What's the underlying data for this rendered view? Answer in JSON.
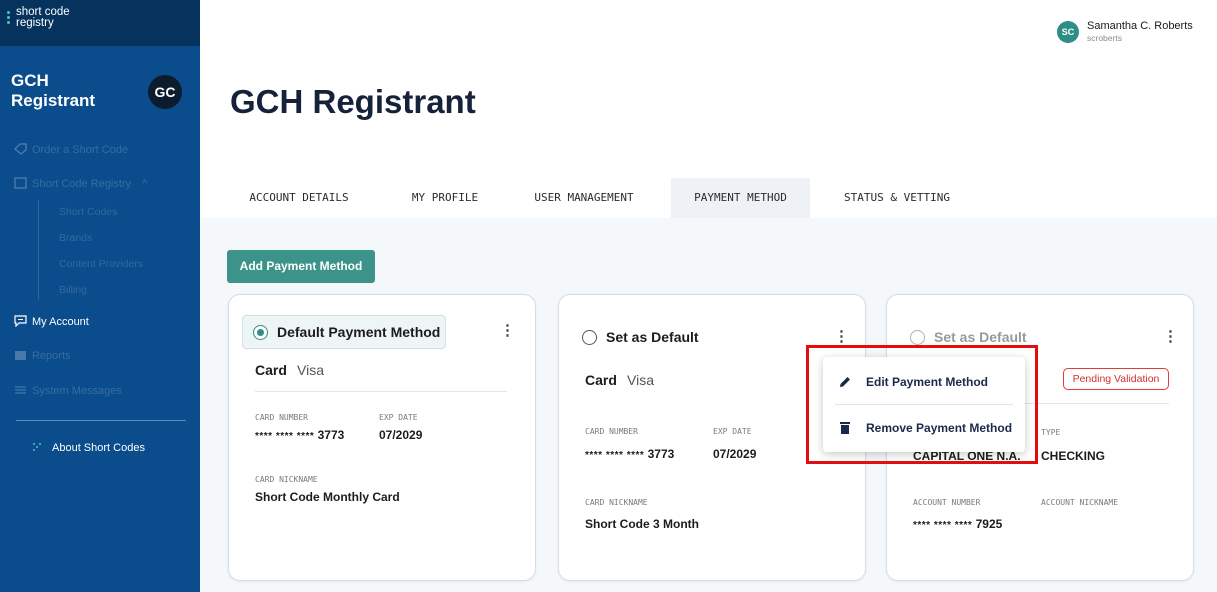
{
  "brand": {
    "line1": "short code",
    "line2": "registry"
  },
  "sidebar": {
    "org_name": "GCH Registrant",
    "org_initials": "GC",
    "items": [
      {
        "label": "Order a Short Code",
        "icon": "tag-icon"
      },
      {
        "label": "Short Code Registry",
        "icon": "registry-icon",
        "expanded_indicator": "^"
      },
      {
        "label": "My Account",
        "icon": "chat-bubble-icon"
      },
      {
        "label": "Reports",
        "icon": "reports-icon"
      },
      {
        "label": "System Messages",
        "icon": "list-icon"
      },
      {
        "label": "About Short Codes",
        "icon": "dots-icon"
      }
    ],
    "sub_items": [
      "Short Codes",
      "Brands",
      "Content Providers",
      "Billing"
    ]
  },
  "user": {
    "initials": "SC",
    "name": "Samantha C. Roberts",
    "handle": "scroberts"
  },
  "page": {
    "title": "GCH Registrant"
  },
  "tabs": [
    {
      "label": "ACCOUNT DETAILS",
      "active": false
    },
    {
      "label": "MY PROFILE",
      "active": false
    },
    {
      "label": "USER MANAGEMENT",
      "active": false
    },
    {
      "label": "PAYMENT METHOD",
      "active": true
    },
    {
      "label": "STATUS & VETTING",
      "active": false
    }
  ],
  "add_button": "Add Payment Method",
  "cards": [
    {
      "radio_label": "Default Payment Method",
      "is_default": true,
      "type": "Card",
      "brand": "Visa",
      "number_label": "CARD NUMBER",
      "number_mask": "**** **** ****",
      "number_last4": "3773",
      "exp_label": "EXP DATE",
      "exp_value": "07/2029",
      "nickname_label": "CARD NICKNAME",
      "nickname": "Short Code Monthly Card"
    },
    {
      "radio_label": "Set as Default",
      "is_default": false,
      "type": "Card",
      "brand": "Visa",
      "number_label": "CARD NUMBER",
      "number_mask": "**** **** ****",
      "number_last4": "3773",
      "exp_label": "EXP DATE",
      "exp_value": "07/2029",
      "nickname_label": "CARD NICKNAME",
      "nickname": "Short Code 3 Month"
    },
    {
      "radio_label": "Set as Default",
      "is_default": false,
      "status_badge": "Pending Validation",
      "type_label": "TYPE",
      "bank_name": "CAPITAL ONE N.A.",
      "account_type": "CHECKING",
      "number_label": "ACCOUNT NUMBER",
      "number_mask": "**** **** ****",
      "number_last4": "7925",
      "nickname_label": "ACCOUNT NICKNAME"
    }
  ],
  "context_menu": {
    "items": [
      {
        "label": "Edit Payment Method",
        "icon": "pencil-icon"
      },
      {
        "label": "Remove Payment Method",
        "icon": "trash-icon"
      }
    ]
  },
  "colors": {
    "sidebar": "#0a4c8c",
    "accent": "#3c9389",
    "highlight": "#e30d0d",
    "pending": "#e23b3b"
  }
}
